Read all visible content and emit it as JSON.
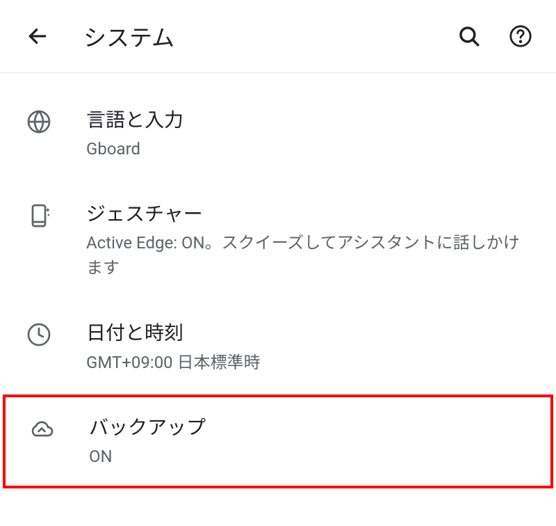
{
  "header": {
    "title": "システム"
  },
  "items": [
    {
      "title": "言語と入力",
      "subtitle": "Gboard"
    },
    {
      "title": "ジェスチャー",
      "subtitle": "Active Edge: ON。スクイーズしてアシスタントに話しかけます"
    },
    {
      "title": "日付と時刻",
      "subtitle": "GMT+09:00 日本標準時"
    },
    {
      "title": "バックアップ",
      "subtitle": "ON"
    }
  ]
}
